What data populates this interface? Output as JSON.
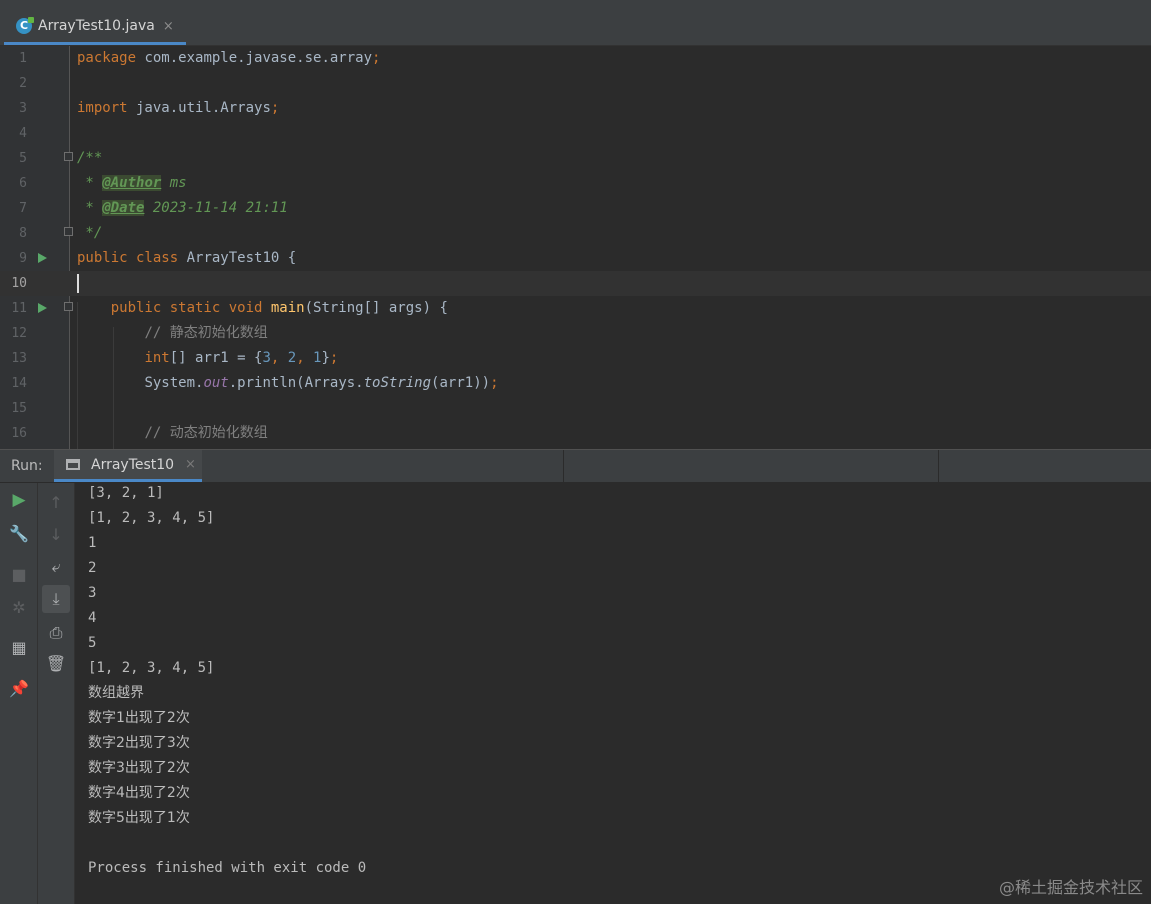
{
  "editor_tab": {
    "icon": "java-class-icon",
    "icon_letter": "C",
    "filename": "ArrayTest10.java",
    "close": "×"
  },
  "code_lines": [
    {
      "n": "1"
    },
    {
      "n": "2"
    },
    {
      "n": "3"
    },
    {
      "n": "4"
    },
    {
      "n": "5"
    },
    {
      "n": "6"
    },
    {
      "n": "7"
    },
    {
      "n": "8"
    },
    {
      "n": "9"
    },
    {
      "n": "10"
    },
    {
      "n": "11"
    },
    {
      "n": "12"
    },
    {
      "n": "13"
    },
    {
      "n": "14"
    },
    {
      "n": "15"
    },
    {
      "n": "16"
    }
  ],
  "code": {
    "l1": {
      "kw": "package",
      "text": " com.example.javase.se.array",
      "semi": ";"
    },
    "l3": {
      "kw": "import",
      "text": " java.util.Arrays",
      "semi": ";"
    },
    "l5": {
      "text": "/**"
    },
    "l6": {
      "star": " * ",
      "tag": "@Author",
      "val": " ms"
    },
    "l7": {
      "star": " * ",
      "tag": "@Date",
      "val": " 2023-11-14 21:11"
    },
    "l8": {
      "text": " */"
    },
    "l9": {
      "kw": "public class",
      "text": " ArrayTest10 {"
    },
    "l11": {
      "indent": "    ",
      "kw": "public static void",
      "fn": "main",
      "text": "(String[] args) {"
    },
    "l12": {
      "indent": "        ",
      "comment": "// 静态初始化数组"
    },
    "l13": {
      "indent": "        ",
      "kw": "int",
      "a": "[] arr1 = {",
      "n1": "3",
      "c1": ", ",
      "n2": "2",
      "c2": ", ",
      "n3": "1",
      "end": "}",
      "semi": ";"
    },
    "l14": {
      "indent": "        ",
      "a": "System.",
      "out": "out",
      "b": ".println(Arrays.",
      "m": "toString",
      "c": "(arr1))",
      "semi": ";"
    },
    "l16": {
      "indent": "        ",
      "comment": "// 动态初始化数组"
    }
  },
  "run_panel": {
    "label": "Run:",
    "tab_label": "ArrayTest10",
    "tab_close": "×"
  },
  "console_output": [
    "[3, 2, 1]",
    "[1, 2, 3, 4, 5]",
    "1",
    "2",
    "3",
    "4",
    "5",
    "[1, 2, 3, 4, 5]",
    "数组越界",
    "数字1出现了2次",
    "数字2出现了3次",
    "数字3出现了2次",
    "数字4出现了2次",
    "数字5出现了1次",
    "",
    "Process finished with exit code 0"
  ],
  "watermark": "@稀土掘金技术社区"
}
